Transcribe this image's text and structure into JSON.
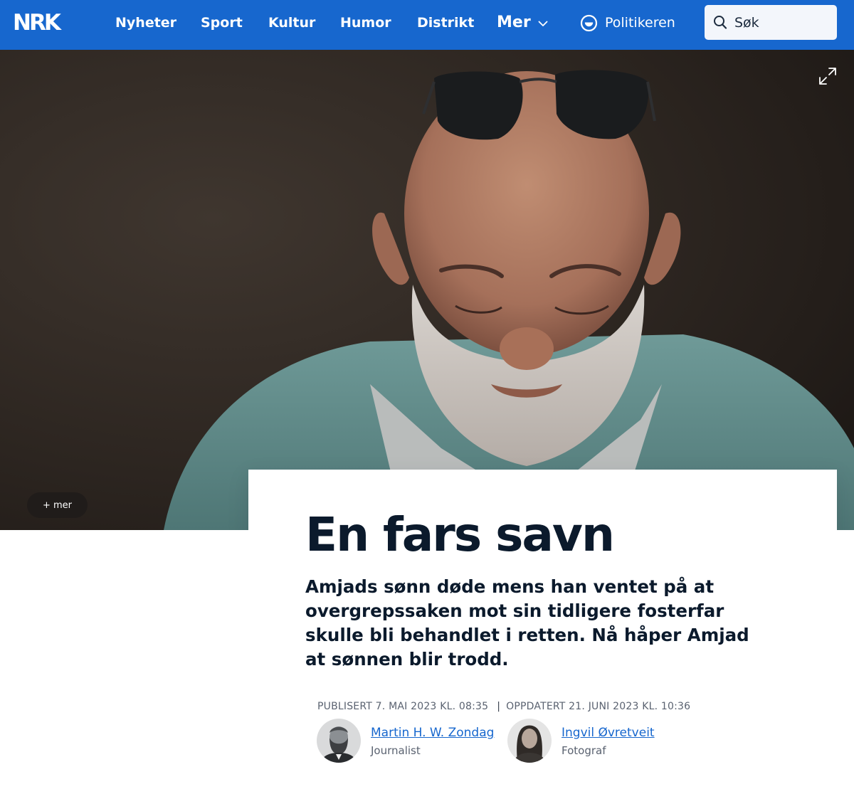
{
  "header": {
    "logo_text": "NRK",
    "nav": [
      {
        "label": "Nyheter"
      },
      {
        "label": "Sport"
      },
      {
        "label": "Kultur"
      },
      {
        "label": "Humor"
      },
      {
        "label": "Distrikt"
      }
    ],
    "more_label": "Mer",
    "more_icon": "chevron-down-icon",
    "politikeren_label": "Politikeren",
    "politikeren_icon": "politikeren-smile-icon",
    "search_placeholder": "Søk",
    "search_icon": "search-icon",
    "brand_color": "#1767ce"
  },
  "hero": {
    "expand_icon": "expand-icon",
    "more_button_label": "+ mer"
  },
  "article": {
    "title": "En fars savn",
    "lead": "Amjads sønn døde mens han ventet på at overgrepssaken mot sin tidligere fosterfar skulle bli behandlet i retten. Nå håper Amjad at sønnen blir trodd.",
    "published": "Publisert 7. mai 2023 kl. 08:35",
    "updated_separator": "|",
    "updated": "Oppdatert 21. juni 2023 kl. 10:36",
    "authors": [
      {
        "name": "Martin H. W. Zondag",
        "role": "Journalist"
      },
      {
        "name": "Ingvil Øvretveit",
        "role": "Fotograf"
      }
    ]
  }
}
